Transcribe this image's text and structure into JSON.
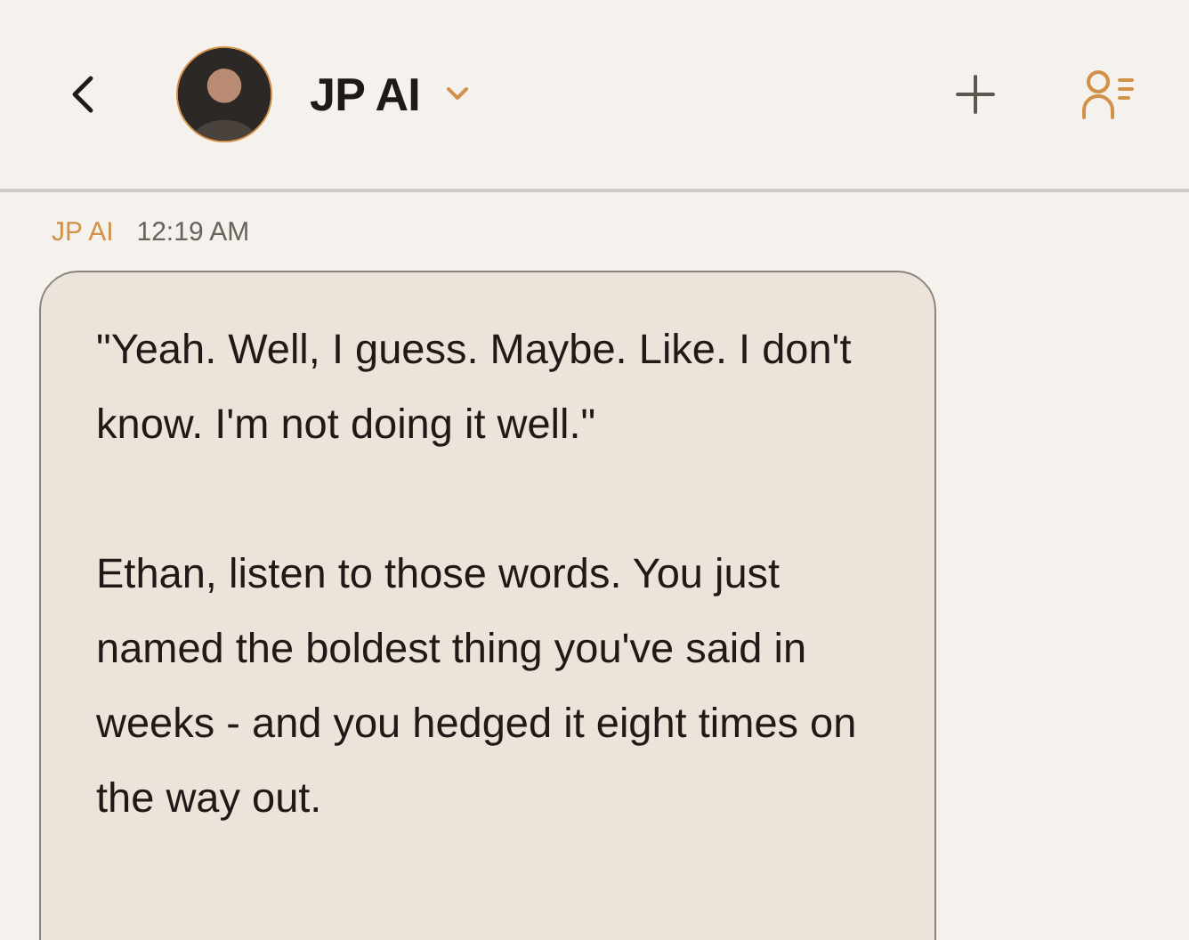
{
  "header": {
    "title": "JP AI"
  },
  "messages": [
    {
      "sender": "JP AI",
      "time": "12:19 AM",
      "paragraphs": [
        "\"Yeah. Well, I guess. Maybe. Like. I don't know. I'm not doing it well.\"",
        "Ethan, listen to those words. You just named the boldest thing you've said in weeks - and you hedged it eight times on the way out."
      ]
    }
  ]
}
